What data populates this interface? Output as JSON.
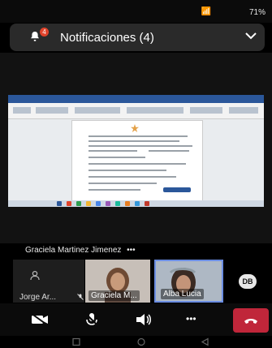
{
  "status_bar": {
    "text": "71%"
  },
  "notifications": {
    "title": "Notificaciones (4)",
    "badge": "4"
  },
  "shared_screen": {
    "presenter": "Graciela Martinez Jimenez",
    "more": "•••"
  },
  "participants": [
    {
      "label": "Jorge Ar...",
      "muted": true
    },
    {
      "label": "Graciela M..."
    },
    {
      "label": "Alba Lucia"
    }
  ],
  "initials": "DB",
  "controls": {
    "more": "•••"
  },
  "colors": {
    "accent_red": "#c0263a",
    "badge": "#e0432b",
    "highlight": "#6c8ee3"
  }
}
